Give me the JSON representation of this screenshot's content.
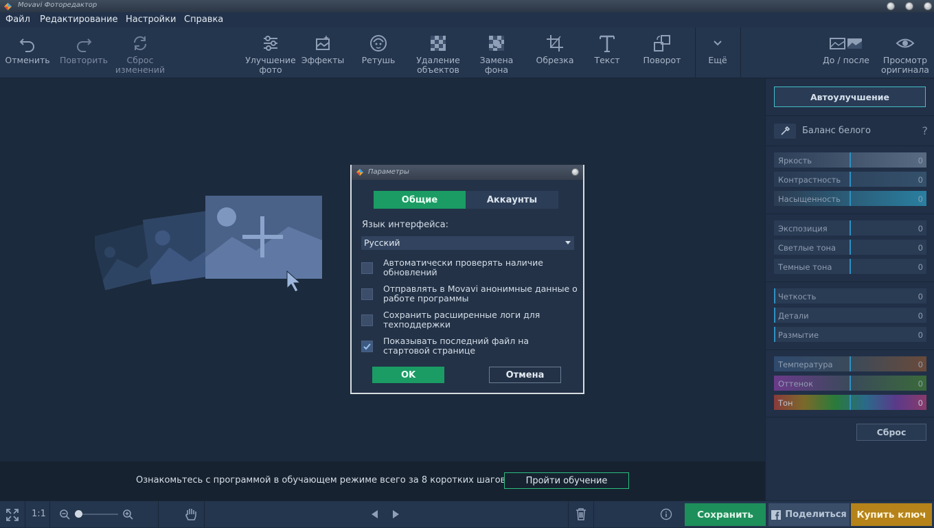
{
  "window": {
    "title": "Movavi Фоторедактор"
  },
  "menu": {
    "file": "Файл",
    "edit": "Редактирование",
    "settings": "Настройки",
    "help": "Справка"
  },
  "toolbar": {
    "undo": "Отменить",
    "redo": "Повторить",
    "reset_changes": [
      "Сброс",
      "изменений"
    ],
    "enhance": [
      "Улучшение",
      "фото"
    ],
    "effects": "Эффекты",
    "retouch": "Ретушь",
    "remove_objects": [
      "Удаление",
      "объектов"
    ],
    "replace_bg": [
      "Замена",
      "фона"
    ],
    "crop": "Обрезка",
    "text": "Текст",
    "rotate": "Поворот",
    "more": "Ещё",
    "before_after": "До / после",
    "preview_original": [
      "Просмотр",
      "оригинала"
    ]
  },
  "panel": {
    "auto_enhance": "Автоулучшение",
    "white_balance": "Баланс белого",
    "help": "?",
    "sliders_group1": [
      {
        "label": "Яркость",
        "value": "0"
      },
      {
        "label": "Контрастность",
        "value": "0"
      },
      {
        "label": "Насыщенность",
        "value": "0"
      }
    ],
    "sliders_group2": [
      {
        "label": "Экспозиция",
        "value": "0"
      },
      {
        "label": "Светлые тона",
        "value": "0"
      },
      {
        "label": "Темные тона",
        "value": "0"
      }
    ],
    "sliders_group3": [
      {
        "label": "Четкость",
        "value": "0"
      },
      {
        "label": "Детали",
        "value": "0"
      },
      {
        "label": "Размытие",
        "value": "0"
      }
    ],
    "sliders_group4": [
      {
        "label": "Температура",
        "value": "0"
      },
      {
        "label": "Оттенок",
        "value": "0"
      },
      {
        "label": "Тон",
        "value": "0"
      }
    ],
    "reset": "Сброс"
  },
  "tutorial": {
    "text": "Ознакомьтесь с программой в обучающем режиме всего за 8 коротких шагов!",
    "button": "Пройти обучение"
  },
  "bottombar": {
    "zoom_1to1": "1:1",
    "save": "Сохранить",
    "share": "Поделиться",
    "buy": "Купить ключ"
  },
  "dialog": {
    "title": "Параметры",
    "tab_general": "Общие",
    "tab_accounts": "Аккаунты",
    "language_label": "Язык интерфейса:",
    "language_value": "Русский",
    "options": [
      {
        "lines": [
          "Автоматически проверять наличие",
          "обновлений"
        ],
        "checked": false
      },
      {
        "lines": [
          "Отправлять в Movavi анонимные данные о",
          "работе программы"
        ],
        "checked": false
      },
      {
        "lines": [
          "Сохранить расширенные логи для",
          "техподдержки"
        ],
        "checked": false
      },
      {
        "lines": [
          "Показывать последний файл на",
          "стартовой странице"
        ],
        "checked": true
      }
    ],
    "ok": "OK",
    "cancel": "Отмена"
  },
  "colors": {
    "accent_green": "#1a9c64",
    "accent_gold": "#b58319",
    "slider_mark": "#2f90c2"
  }
}
